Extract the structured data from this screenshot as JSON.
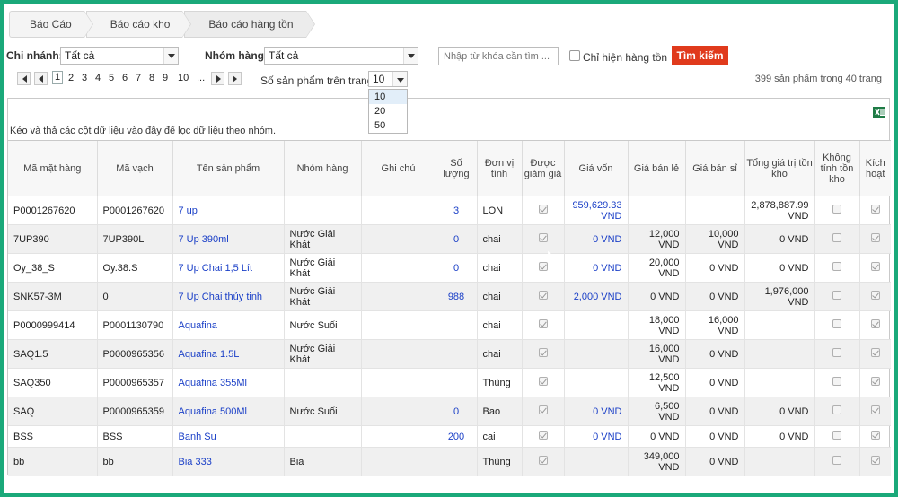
{
  "breadcrumb": [
    "Báo Cáo",
    "Báo cáo kho",
    "Báo cáo hàng tồn"
  ],
  "filters": {
    "branch_label": "Chi nhánh:",
    "branch_value": "Tất cả",
    "group_label": "Nhóm hàng:",
    "group_value": "Tất cả",
    "search_placeholder": "Nhập từ khóa cần tìm ...",
    "only_stock_label": "Chỉ hiện hàng tồn",
    "search_button": "Tìm kiếm"
  },
  "pager": {
    "pages": [
      "1",
      "2",
      "3",
      "4",
      "5",
      "6",
      "7",
      "8",
      "9",
      "10",
      "..."
    ],
    "current": "1",
    "page_size_label": "Số sản phẩm trên trang:",
    "page_size": "10",
    "page_size_options": [
      "10",
      "20",
      "50"
    ],
    "count_text": "399 sản phẩm trong 40 trang"
  },
  "grid": {
    "group_hint": "Kéo và thả các cột dữ liệu vào đây để lọc dữ liệu theo nhóm.",
    "columns": [
      "Mã mặt hàng",
      "Mã vạch",
      "Tên sản phẩm",
      "Nhóm hàng",
      "Ghi chú",
      "Số lượng",
      "Đơn vị tính",
      "Được giảm giá",
      "Giá vốn",
      "Giá bán lẻ",
      "Giá bán sỉ",
      "Tổng giá trị tồn kho",
      "Không tính tồn kho",
      "Kích hoạt"
    ],
    "rows": [
      {
        "code": "P0001267620",
        "barcode": "P0001267620",
        "name": "7 up",
        "group": "",
        "note": "",
        "qty": "3",
        "unit": "LON",
        "cost": "959,629.33 VND",
        "retail": "",
        "wholesale": "",
        "total": "2,878,887.99 VND"
      },
      {
        "code": "7UP390",
        "barcode": "7UP390L",
        "name": "7 Up 390ml",
        "group": "Nước Giải Khát",
        "note": "",
        "qty": "0",
        "unit": "chai",
        "cost": "0 VND",
        "retail": "12,000 VND",
        "wholesale": "10,000 VND",
        "total": "0 VND"
      },
      {
        "code": "Oy_38_S",
        "barcode": "Oy.38.S",
        "name": "7 Up Chai 1,5 Lít",
        "group": "Nước Giải Khát",
        "note": "",
        "qty": "0",
        "unit": "chai",
        "cost": "0 VND",
        "retail": "20,000 VND",
        "wholesale": "0 VND",
        "total": "0 VND"
      },
      {
        "code": "SNK57-3M",
        "barcode": "0",
        "name": "7 Up Chai thủy tinh",
        "group": "Nước Giải Khát",
        "note": "",
        "qty": "988",
        "unit": "chai",
        "cost": "2,000 VND",
        "retail": "0 VND",
        "wholesale": "0 VND",
        "total": "1,976,000 VND"
      },
      {
        "code": "P0000999414",
        "barcode": "P0001130790",
        "name": "Aquafina",
        "group": "Nước Suối",
        "note": "",
        "qty": "",
        "unit": "chai",
        "cost": "",
        "retail": "18,000 VND",
        "wholesale": "16,000 VND",
        "total": ""
      },
      {
        "code": "SAQ1.5",
        "barcode": "P0000965356",
        "name": "Aquafina 1.5L",
        "group": "Nước Giải Khát",
        "note": "",
        "qty": "",
        "unit": "chai",
        "cost": "",
        "retail": "16,000 VND",
        "wholesale": "0 VND",
        "total": ""
      },
      {
        "code": "SAQ350",
        "barcode": "P0000965357",
        "name": "Aquafina 355Ml",
        "group": "",
        "note": "",
        "qty": "",
        "unit": "Thùng",
        "cost": "",
        "retail": "12,500 VND",
        "wholesale": "0 VND",
        "total": ""
      },
      {
        "code": "SAQ",
        "barcode": "P0000965359",
        "name": "Aquafina 500Ml",
        "group": "Nước Suối",
        "note": "",
        "qty": "0",
        "unit": "Bao",
        "cost": "0 VND",
        "retail": "6,500 VND",
        "wholesale": "0 VND",
        "total": "0 VND"
      },
      {
        "code": "BSS",
        "barcode": "BSS",
        "name": "Banh Su",
        "group": "",
        "note": "",
        "qty": "200",
        "unit": "cai",
        "cost": "0 VND",
        "retail": "0 VND",
        "wholesale": "0 VND",
        "total": "0 VND"
      },
      {
        "code": "bb",
        "barcode": "bb",
        "name": "Bia 333",
        "group": "Bia",
        "note": "",
        "qty": "",
        "unit": "Thùng",
        "cost": "",
        "retail": "349,000 VND",
        "wholesale": "0 VND",
        "total": ""
      }
    ]
  }
}
